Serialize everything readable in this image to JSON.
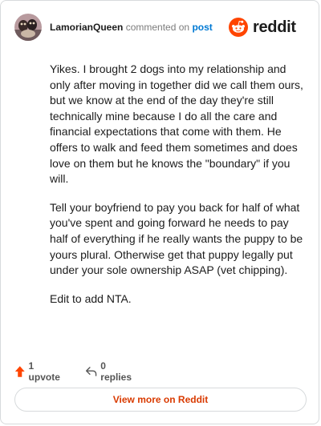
{
  "header": {
    "username": "LamorianQueen",
    "commented_text": "commented on",
    "post_link": "post",
    "brand": "reddit"
  },
  "comment": {
    "paragraphs": [
      "Yikes. I brought 2 dogs into my relationship and only after moving in together did we call them ours, but we know at the end of the day they're still technically mine because I do all the care and financial expectations that come with them. He offers to walk and feed them sometimes and does love on them but he knows the \"boundary\" if you will.",
      "Tell your boyfriend to pay you back for half of what you've spent and going forward he needs to pay half of everything if he really wants the puppy to be yours plural. Otherwise get that puppy legally put under your sole ownership ASAP (vet chipping).",
      "Edit to add NTA."
    ]
  },
  "actions": {
    "upvotes": "1 upvote",
    "replies": "0 replies"
  },
  "footer": {
    "view_more": "View more on Reddit"
  },
  "colors": {
    "accent": "#d93a00",
    "link": "#0079d3",
    "reddit_orange": "#ff4500"
  },
  "icons": [
    "avatar",
    "reddit-logo-icon",
    "upvote-arrow-icon",
    "reply-icon"
  ]
}
